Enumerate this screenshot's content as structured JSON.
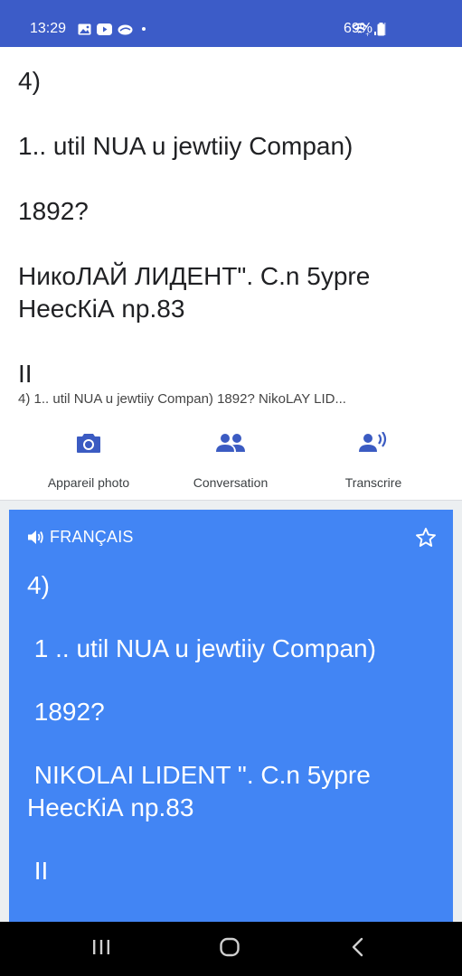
{
  "status_bar": {
    "time": "13:29",
    "battery_percent": "69%",
    "left_icons": [
      "image-icon",
      "youtube-icon",
      "cloud-icon",
      "dot-icon"
    ],
    "right_icons": [
      "wifi-icon",
      "signal-icon",
      "battery-icon"
    ]
  },
  "source": {
    "lines": [
      "4)",
      "1.. util NUA u jewtiiy Compan)",
      "1892?",
      "НикоЛАЙ ЛИДЕНТ\". С.n 5ypre\nНеесКіА np.83",
      "II"
    ],
    "summary": "4)  1.. util NUA u jewtiiy Compan)  1892?  NikoLAY LID..."
  },
  "tools": {
    "camera": "Appareil photo",
    "conversation": "Conversation",
    "transcribe": "Transcrire"
  },
  "translation": {
    "language": "FRANÇAIS",
    "lines": [
      "4)",
      " 1 .. util NUA u jewtiiy Compan)",
      " 1892?",
      " NIKOLAI LIDENT \". C.n 5ypre\nНеесКіА np.83",
      " II"
    ]
  },
  "colors": {
    "status_bar": "#3c5cc8",
    "accent_blue": "#4285f4",
    "icon_blue": "#3b5bc2",
    "nav_bar": "#000000"
  }
}
